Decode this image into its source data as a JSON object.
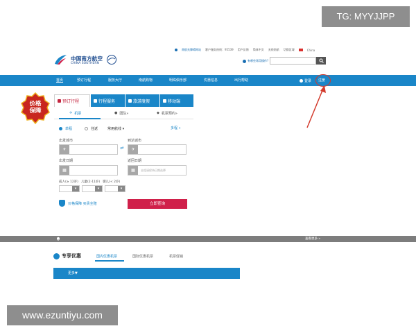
{
  "watermarks": {
    "tg": "TG: MYYJJPP",
    "site": "www.ezuntiyu.com"
  },
  "header": {
    "logo_cn": "中国南方航空",
    "logo_en": "CHINA SOUTHERN",
    "top_links": [
      "南航无障碍网站",
      "客户服务热线：95539",
      "用户反馈",
      "简体中文"
    ],
    "right_links": [
      "无线南航",
      "切换区域"
    ],
    "region": "China",
    "helper": "有哪些常用操作?",
    "search_placeholder": ""
  },
  "nav": {
    "items": [
      "首页",
      "预订行程",
      "服务大厅",
      "南航购物",
      "明珠俱乐部",
      "优惠信息",
      "出行帮助"
    ],
    "login": "登录",
    "register": "注册"
  },
  "badge": {
    "line1": "价格",
    "line2": "保障"
  },
  "booking": {
    "tabs": [
      "预订行程",
      "行程服务",
      "旅游度假",
      "移动端"
    ],
    "subtabs": [
      "机票",
      "团队»",
      "机票预约»"
    ],
    "trip_types": [
      "单程",
      "往返"
    ],
    "common_route": "常用航线",
    "multi": "多程 »",
    "labels": {
      "from": "出发城市",
      "to": "到达城市",
      "depart_date": "出发日期",
      "return_date": "返回日期",
      "return_placeholder": "去程请保持日期选择",
      "adult": "成人(≥ 12岁)",
      "child": "儿童(2-11岁)",
      "infant": "婴儿(< 2岁)"
    },
    "adult_count": "1",
    "child_count": "0",
    "infant_count": "0",
    "guarantee": "价格保障 买贵全赔",
    "submit": "立即查询"
  },
  "notice": {
    "more": "查看更多 »"
  },
  "offers": {
    "title": "专享优惠",
    "tabs": [
      "国内优惠机票",
      "国际优惠机票",
      "机票促销"
    ],
    "bar": "更多▼"
  },
  "colors": {
    "brand_blue": "#1a86c8",
    "accent_red": "#d0204a",
    "highlight": "#d33a2c"
  }
}
